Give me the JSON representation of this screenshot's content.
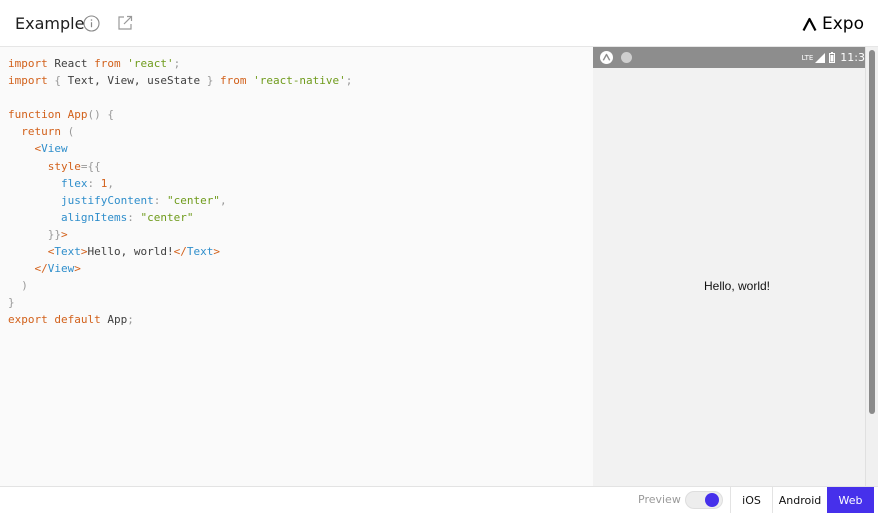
{
  "header": {
    "title": "Example",
    "brand": "Expo",
    "icons": [
      "info-icon",
      "external-link-icon",
      "expo-logo-icon"
    ]
  },
  "editor": {
    "lines": [
      [
        {
          "t": "import",
          "c": "k"
        },
        {
          "t": " React ",
          "c": ""
        },
        {
          "t": "from",
          "c": "k"
        },
        {
          "t": " ",
          "c": ""
        },
        {
          "t": "'react'",
          "c": "s"
        },
        {
          "t": ";",
          "c": "p"
        }
      ],
      [
        {
          "t": "import",
          "c": "k"
        },
        {
          "t": " ",
          "c": ""
        },
        {
          "t": "{",
          "c": "p"
        },
        {
          "t": " Text, View, useState ",
          "c": ""
        },
        {
          "t": "}",
          "c": "p"
        },
        {
          "t": " ",
          "c": ""
        },
        {
          "t": "from",
          "c": "k"
        },
        {
          "t": " ",
          "c": ""
        },
        {
          "t": "'react-native'",
          "c": "s"
        },
        {
          "t": ";",
          "c": "p"
        }
      ],
      [],
      [
        {
          "t": "function",
          "c": "k"
        },
        {
          "t": " ",
          "c": ""
        },
        {
          "t": "App",
          "c": "k"
        },
        {
          "t": "() {",
          "c": "p"
        }
      ],
      [
        {
          "t": "  ",
          "c": ""
        },
        {
          "t": "return",
          "c": "k"
        },
        {
          "t": " (",
          "c": "p"
        }
      ],
      [
        {
          "t": "    ",
          "c": ""
        },
        {
          "t": "<",
          "c": "k"
        },
        {
          "t": "View",
          "c": "t"
        }
      ],
      [
        {
          "t": "      ",
          "c": ""
        },
        {
          "t": "style",
          "c": "k"
        },
        {
          "t": "={{",
          "c": "p"
        }
      ],
      [
        {
          "t": "        flex",
          "c": "t"
        },
        {
          "t": ": ",
          "c": "p"
        },
        {
          "t": "1",
          "c": "k"
        },
        {
          "t": ",",
          "c": "p"
        }
      ],
      [
        {
          "t": "        justifyContent",
          "c": "t"
        },
        {
          "t": ": ",
          "c": "p"
        },
        {
          "t": "\"center\"",
          "c": "s"
        },
        {
          "t": ",",
          "c": "p"
        }
      ],
      [
        {
          "t": "        alignItems",
          "c": "t"
        },
        {
          "t": ": ",
          "c": "p"
        },
        {
          "t": "\"center\"",
          "c": "s"
        }
      ],
      [
        {
          "t": "      }}",
          "c": "p"
        },
        {
          "t": ">",
          "c": "k"
        }
      ],
      [
        {
          "t": "      ",
          "c": ""
        },
        {
          "t": "<",
          "c": "k"
        },
        {
          "t": "Text",
          "c": "t"
        },
        {
          "t": ">",
          "c": "k"
        },
        {
          "t": "Hello, world!",
          "c": ""
        },
        {
          "t": "</",
          "c": "k"
        },
        {
          "t": "Text",
          "c": "t"
        },
        {
          "t": ">",
          "c": "k"
        }
      ],
      [
        {
          "t": "    ",
          "c": ""
        },
        {
          "t": "</",
          "c": "k"
        },
        {
          "t": "View",
          "c": "t"
        },
        {
          "t": ">",
          "c": "k"
        }
      ],
      [
        {
          "t": "  )",
          "c": "p"
        }
      ],
      [
        {
          "t": "}",
          "c": "p"
        }
      ],
      [
        {
          "t": "export",
          "c": "k"
        },
        {
          "t": " ",
          "c": ""
        },
        {
          "t": "default",
          "c": "k"
        },
        {
          "t": " App",
          "c": ""
        },
        {
          "t": ";",
          "c": "p"
        }
      ]
    ]
  },
  "device": {
    "status_time": "11:3",
    "status_network": "LTE",
    "hello_text": "Hello, world!"
  },
  "footer": {
    "preview_label": "Preview",
    "preview_on": true,
    "platforms": [
      "iOS",
      "Android",
      "Web"
    ],
    "active_platform": "Web"
  },
  "colors": {
    "accent": "#4630eb",
    "keyword": "#d2611b",
    "string": "#6f9b1c",
    "tag": "#2f8ecb",
    "punctuation": "#999999"
  }
}
